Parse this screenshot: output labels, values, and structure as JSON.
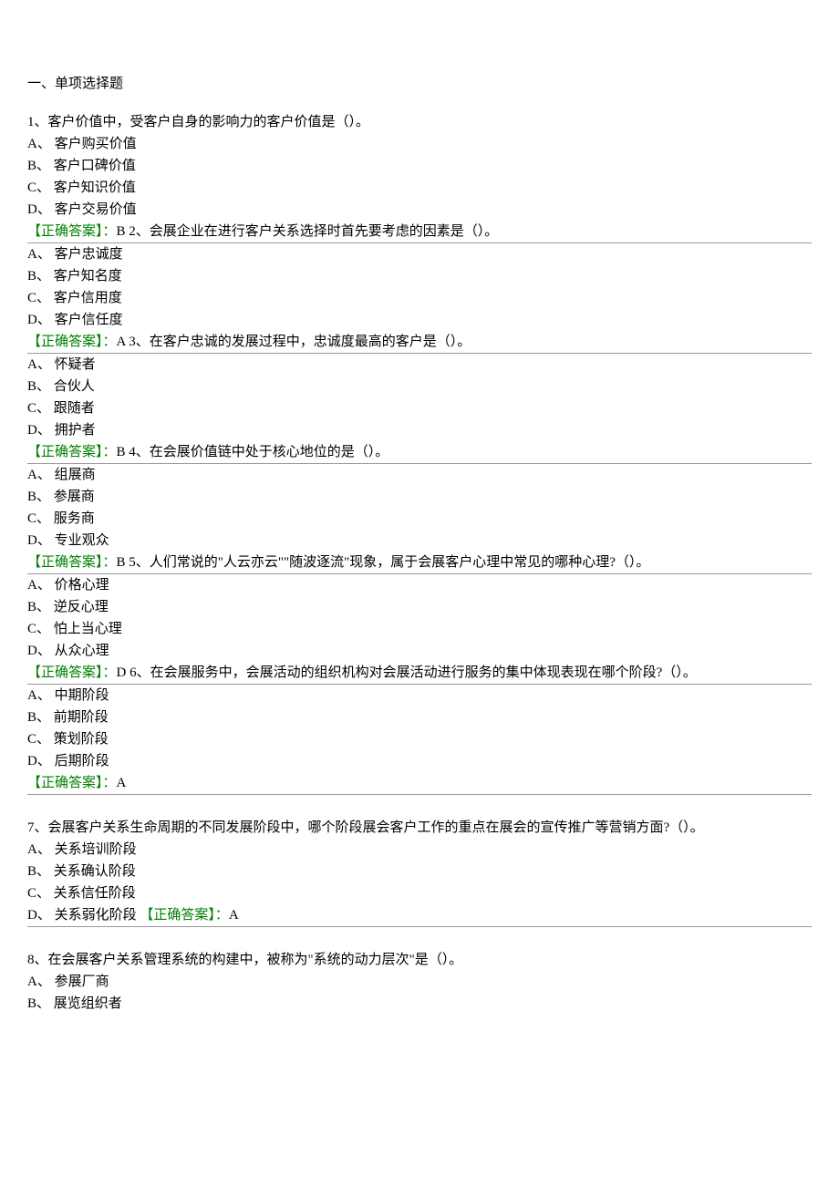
{
  "section_title": "一、单项选择题",
  "answer_label": "【正确答案】：",
  "questions": [
    {
      "stem": "1、客户价值中，受客户自身的影响力的客户价值是（）。",
      "options": [
        "A、 客户购买价值",
        "B、 客户口碑价值",
        "C、 客户知识价值",
        "D、 客户交易价值"
      ],
      "answer": "B",
      "inline_next": "2、会展企业在进行客户关系选择时首先要考虑的因素是（）。"
    },
    {
      "options": [
        "A、 客户忠诚度",
        "B、 客户知名度",
        "C、 客户信用度",
        "D、 客户信任度"
      ],
      "answer": "A",
      "inline_next": "3、在客户忠诚的发展过程中，忠诚度最高的客户是（）。"
    },
    {
      "options": [
        "A、 怀疑者",
        "B、 合伙人",
        "C、 跟随者",
        "D、 拥护者"
      ],
      "answer": "B",
      "inline_next": "4、在会展价值链中处于核心地位的是（）。"
    },
    {
      "options": [
        "A、 组展商",
        "B、 参展商",
        "C、 服务商",
        "D、 专业观众"
      ],
      "answer": "B",
      "inline_next": "5、人们常说的\"人云亦云\"\"随波逐流\"现象，属于会展客户心理中常见的哪种心理?（）。"
    },
    {
      "options": [
        "A、 价格心理",
        "B、 逆反心理",
        "C、 怕上当心理",
        "D、 从众心理"
      ],
      "answer": "D",
      "inline_next": "6、在会展服务中，会展活动的组织机构对会展活动进行服务的集中体现表现在哪个阶段?（）。"
    },
    {
      "options": [
        "A、 中期阶段",
        "B、 前期阶段",
        "C、 策划阶段",
        "D、 后期阶段"
      ],
      "answer": "A",
      "gap_after": true
    },
    {
      "stem": "7、会展客户关系生命周期的不同发展阶段中，哪个阶段展会客户工作的重点在展会的宣传推广等营销方面?（）。",
      "options": [
        "A、 关系培训阶段",
        "B、 关系确认阶段",
        "C、 关系信任阶段"
      ],
      "last_option": "D、 关系弱化阶段",
      "answer_inline_last": "A",
      "gap_after": true
    },
    {
      "stem": "8、在会展客户关系管理系统的构建中，被称为\"系统的动力层次\"是（）。",
      "options": [
        "A、 参展厂商",
        "B、 展览组织者"
      ]
    }
  ]
}
